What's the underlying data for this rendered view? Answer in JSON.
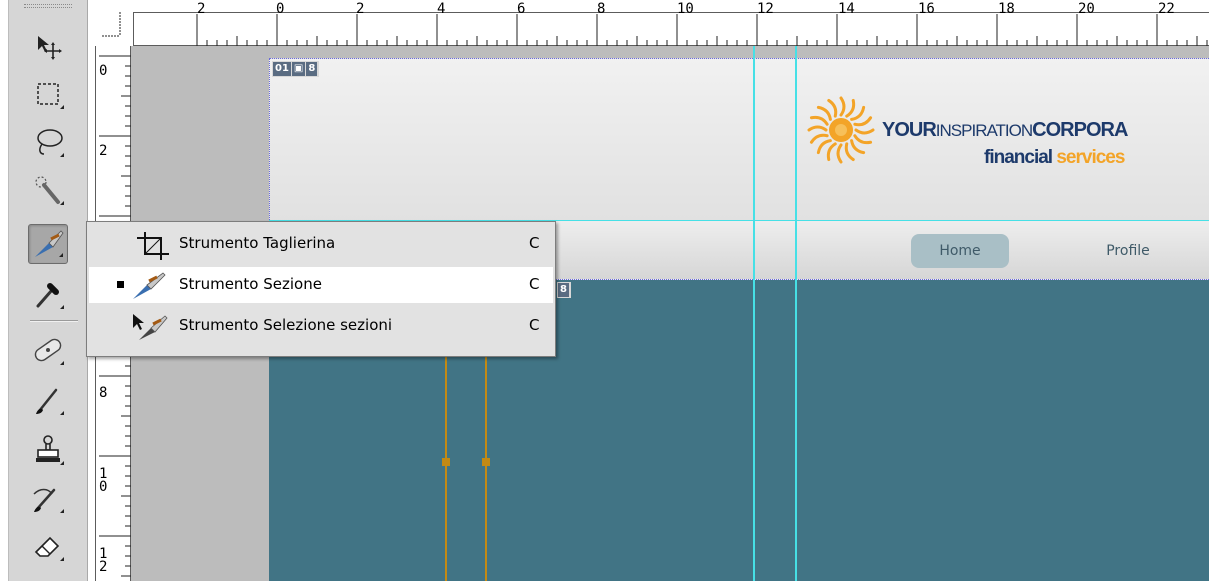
{
  "ruler": {
    "top_labels": [
      "2",
      "0",
      "2",
      "4",
      "6",
      "8",
      "10",
      "12",
      "14",
      "16",
      "18",
      "20",
      "22"
    ],
    "left_labels": [
      "0",
      "2",
      "8",
      "1\n0",
      "1\n2"
    ]
  },
  "toolbar": {
    "tools": [
      "move-tool",
      "marquee-tool",
      "lasso-tool",
      "quick-selection-tool",
      "slice-tool",
      "eyedropper-tool",
      "healing-brush-tool",
      "brush-tool",
      "clone-stamp-tool",
      "history-brush-tool",
      "eraser-tool"
    ],
    "active_tool": "slice-tool"
  },
  "flyout": {
    "items": [
      {
        "label": "Strumento Taglierina",
        "shortcut": "C",
        "selected": false,
        "icon": "crop-icon"
      },
      {
        "label": "Strumento Sezione",
        "shortcut": "C",
        "selected": true,
        "icon": "slice-icon"
      },
      {
        "label": "Strumento Selezione sezioni",
        "shortcut": "C",
        "selected": false,
        "icon": "slice-select-icon"
      }
    ]
  },
  "canvas": {
    "slice_badge_top": [
      "01",
      "▣",
      "8"
    ],
    "slice_badge_body": "8",
    "logo": {
      "line1_bold_a": "YOUR",
      "line1_regular": "INSPIRATION",
      "line1_bold_b": "CORPORA",
      "line2_a": "financial",
      "line2_b": "services"
    },
    "nav": {
      "home": "Home",
      "profile": "Profile"
    }
  },
  "colors": {
    "toolbar_bg": "#d6d6d6",
    "pasteboard": "#bcbcbc",
    "doc_body": "#417485",
    "guide": "#46e0e6",
    "slice_line": "#c38a14",
    "logo_navy": "#1d3a6b",
    "logo_orange": "#f3a428",
    "nav_active": "#a9bfc6"
  }
}
